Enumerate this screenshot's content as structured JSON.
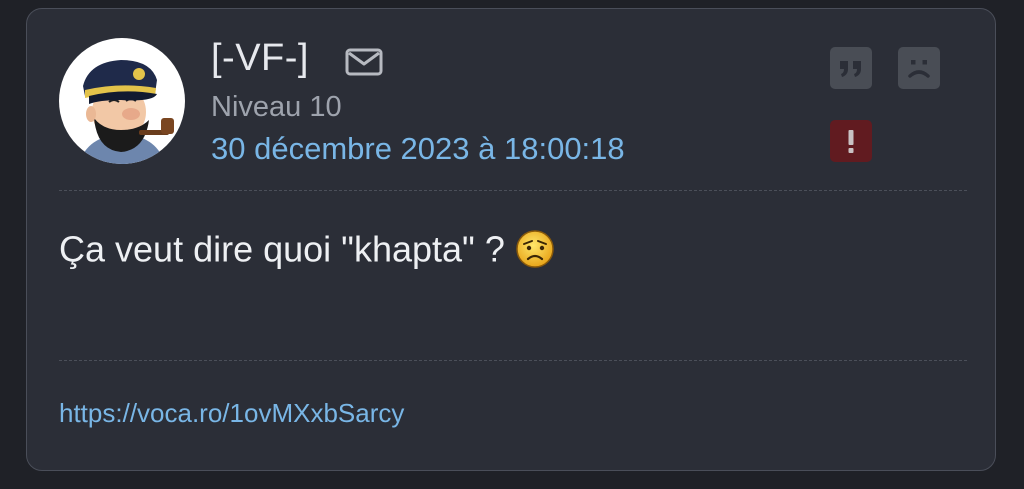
{
  "post": {
    "username": "[-VF-]",
    "level": "Niveau 10",
    "date": "30 décembre 2023 à 18:00:18",
    "message": "Ça veut dire quoi \"khapta\" ?",
    "signature_link": "https://voca.ro/1ovMXxbSarcy"
  },
  "icons": {
    "avatar": "captain-haddock-avatar",
    "mail": "envelope-icon",
    "quote": "quote-icon",
    "sad": "sad-face-icon",
    "report": "exclamation-icon",
    "emoji": "confused-emoji-icon"
  },
  "colors": {
    "background": "#1f2127",
    "card": "#2b2e37",
    "link": "#79b6e6",
    "report": "#611b20",
    "action": "#494d55"
  }
}
